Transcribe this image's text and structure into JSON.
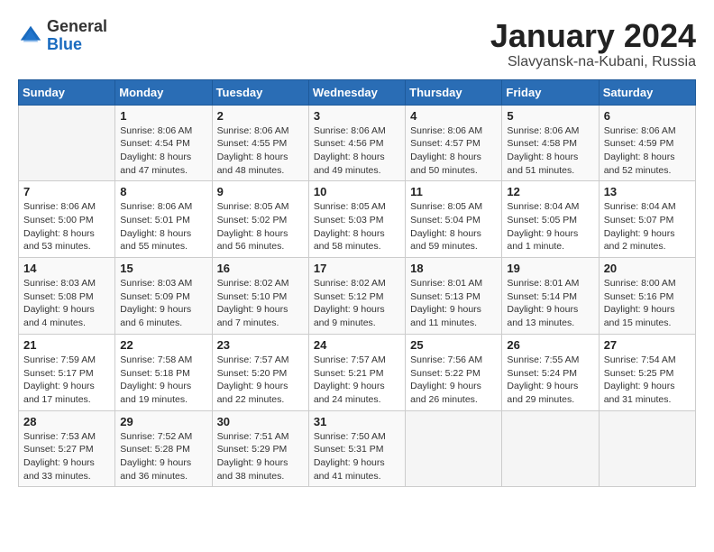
{
  "header": {
    "logo": {
      "general": "General",
      "blue": "Blue"
    },
    "title": "January 2024",
    "subtitle": "Slavyansk-na-Kubani, Russia"
  },
  "days_of_week": [
    "Sunday",
    "Monday",
    "Tuesday",
    "Wednesday",
    "Thursday",
    "Friday",
    "Saturday"
  ],
  "weeks": [
    [
      {
        "day": "",
        "info": ""
      },
      {
        "day": "1",
        "info": "Sunrise: 8:06 AM\nSunset: 4:54 PM\nDaylight: 8 hours\nand 47 minutes."
      },
      {
        "day": "2",
        "info": "Sunrise: 8:06 AM\nSunset: 4:55 PM\nDaylight: 8 hours\nand 48 minutes."
      },
      {
        "day": "3",
        "info": "Sunrise: 8:06 AM\nSunset: 4:56 PM\nDaylight: 8 hours\nand 49 minutes."
      },
      {
        "day": "4",
        "info": "Sunrise: 8:06 AM\nSunset: 4:57 PM\nDaylight: 8 hours\nand 50 minutes."
      },
      {
        "day": "5",
        "info": "Sunrise: 8:06 AM\nSunset: 4:58 PM\nDaylight: 8 hours\nand 51 minutes."
      },
      {
        "day": "6",
        "info": "Sunrise: 8:06 AM\nSunset: 4:59 PM\nDaylight: 8 hours\nand 52 minutes."
      }
    ],
    [
      {
        "day": "7",
        "info": "Sunrise: 8:06 AM\nSunset: 5:00 PM\nDaylight: 8 hours\nand 53 minutes."
      },
      {
        "day": "8",
        "info": "Sunrise: 8:06 AM\nSunset: 5:01 PM\nDaylight: 8 hours\nand 55 minutes."
      },
      {
        "day": "9",
        "info": "Sunrise: 8:05 AM\nSunset: 5:02 PM\nDaylight: 8 hours\nand 56 minutes."
      },
      {
        "day": "10",
        "info": "Sunrise: 8:05 AM\nSunset: 5:03 PM\nDaylight: 8 hours\nand 58 minutes."
      },
      {
        "day": "11",
        "info": "Sunrise: 8:05 AM\nSunset: 5:04 PM\nDaylight: 8 hours\nand 59 minutes."
      },
      {
        "day": "12",
        "info": "Sunrise: 8:04 AM\nSunset: 5:05 PM\nDaylight: 9 hours\nand 1 minute."
      },
      {
        "day": "13",
        "info": "Sunrise: 8:04 AM\nSunset: 5:07 PM\nDaylight: 9 hours\nand 2 minutes."
      }
    ],
    [
      {
        "day": "14",
        "info": "Sunrise: 8:03 AM\nSunset: 5:08 PM\nDaylight: 9 hours\nand 4 minutes."
      },
      {
        "day": "15",
        "info": "Sunrise: 8:03 AM\nSunset: 5:09 PM\nDaylight: 9 hours\nand 6 minutes."
      },
      {
        "day": "16",
        "info": "Sunrise: 8:02 AM\nSunset: 5:10 PM\nDaylight: 9 hours\nand 7 minutes."
      },
      {
        "day": "17",
        "info": "Sunrise: 8:02 AM\nSunset: 5:12 PM\nDaylight: 9 hours\nand 9 minutes."
      },
      {
        "day": "18",
        "info": "Sunrise: 8:01 AM\nSunset: 5:13 PM\nDaylight: 9 hours\nand 11 minutes."
      },
      {
        "day": "19",
        "info": "Sunrise: 8:01 AM\nSunset: 5:14 PM\nDaylight: 9 hours\nand 13 minutes."
      },
      {
        "day": "20",
        "info": "Sunrise: 8:00 AM\nSunset: 5:16 PM\nDaylight: 9 hours\nand 15 minutes."
      }
    ],
    [
      {
        "day": "21",
        "info": "Sunrise: 7:59 AM\nSunset: 5:17 PM\nDaylight: 9 hours\nand 17 minutes."
      },
      {
        "day": "22",
        "info": "Sunrise: 7:58 AM\nSunset: 5:18 PM\nDaylight: 9 hours\nand 19 minutes."
      },
      {
        "day": "23",
        "info": "Sunrise: 7:57 AM\nSunset: 5:20 PM\nDaylight: 9 hours\nand 22 minutes."
      },
      {
        "day": "24",
        "info": "Sunrise: 7:57 AM\nSunset: 5:21 PM\nDaylight: 9 hours\nand 24 minutes."
      },
      {
        "day": "25",
        "info": "Sunrise: 7:56 AM\nSunset: 5:22 PM\nDaylight: 9 hours\nand 26 minutes."
      },
      {
        "day": "26",
        "info": "Sunrise: 7:55 AM\nSunset: 5:24 PM\nDaylight: 9 hours\nand 29 minutes."
      },
      {
        "day": "27",
        "info": "Sunrise: 7:54 AM\nSunset: 5:25 PM\nDaylight: 9 hours\nand 31 minutes."
      }
    ],
    [
      {
        "day": "28",
        "info": "Sunrise: 7:53 AM\nSunset: 5:27 PM\nDaylight: 9 hours\nand 33 minutes."
      },
      {
        "day": "29",
        "info": "Sunrise: 7:52 AM\nSunset: 5:28 PM\nDaylight: 9 hours\nand 36 minutes."
      },
      {
        "day": "30",
        "info": "Sunrise: 7:51 AM\nSunset: 5:29 PM\nDaylight: 9 hours\nand 38 minutes."
      },
      {
        "day": "31",
        "info": "Sunrise: 7:50 AM\nSunset: 5:31 PM\nDaylight: 9 hours\nand 41 minutes."
      },
      {
        "day": "",
        "info": ""
      },
      {
        "day": "",
        "info": ""
      },
      {
        "day": "",
        "info": ""
      }
    ]
  ]
}
